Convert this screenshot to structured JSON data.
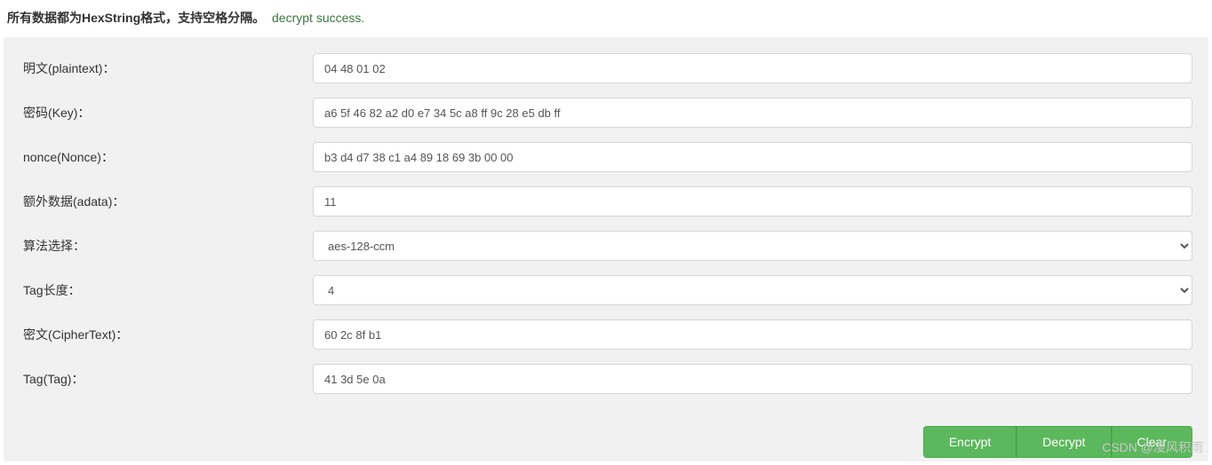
{
  "header": {
    "note": "所有数据都为HexString格式，支持空格分隔。",
    "status": "decrypt success."
  },
  "form": {
    "plaintext": {
      "label": "明文(plaintext)：",
      "value": "04 48 01 02"
    },
    "key": {
      "label": "密码(Key)：",
      "value": "a6 5f 46 82 a2 d0 e7 34 5c a8 ff 9c 28 e5 db ff"
    },
    "nonce": {
      "label": "nonce(Nonce)：",
      "value": "b3 d4 d7 38 c1 a4 89 18 69 3b 00 00"
    },
    "adata": {
      "label": "额外数据(adata)：",
      "value": "11"
    },
    "algorithm": {
      "label": "算法选择：",
      "value": "aes-128-ccm"
    },
    "taglen": {
      "label": "Tag长度：",
      "value": "4"
    },
    "ciphertext": {
      "label": "密文(CipherText)：",
      "value": "60 2c 8f b1"
    },
    "tag": {
      "label": "Tag(Tag)：",
      "value": "41 3d 5e 0a"
    }
  },
  "buttons": {
    "encrypt": "Encrypt",
    "decrypt": "Decrypt",
    "clear": "Clear"
  },
  "watermark": "CSDN @凌风积雨"
}
